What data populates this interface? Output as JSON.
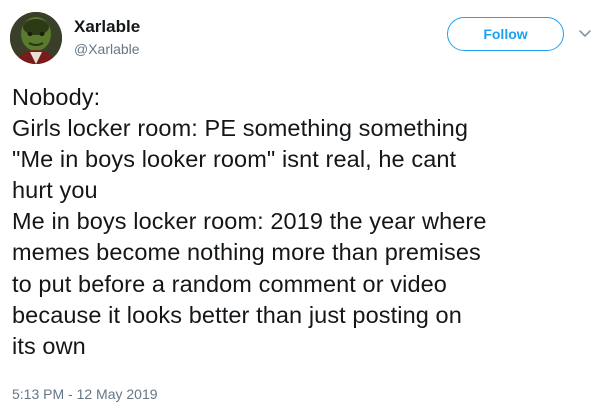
{
  "author": {
    "display_name": "Xarlable",
    "handle": "@Xarlable",
    "avatar_icon": "profile-avatar"
  },
  "actions": {
    "follow_label": "Follow",
    "caret_icon": "chevron-down-icon"
  },
  "tweet": {
    "lines": [
      "Nobody:",
      "Girls locker room: PE something something",
      "\"Me in boys looker room\" isnt real, he cant",
      "hurt you",
      "Me in boys locker room: 2019 the year where",
      "memes become nothing more than premises",
      "to put before a random comment or video",
      "because it looks better than just posting on",
      "its own"
    ],
    "timestamp": "5:13 PM - 12 May 2019"
  },
  "colors": {
    "accent": "#1da1f2",
    "text": "#14171a",
    "secondary_text": "#657786",
    "background": "#ffffff"
  }
}
